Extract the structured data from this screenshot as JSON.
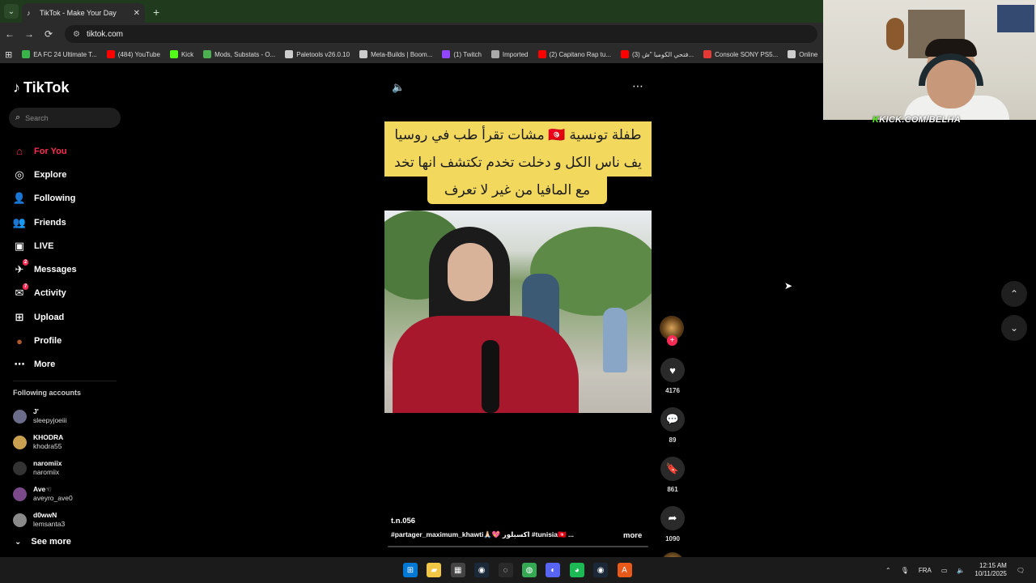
{
  "browser": {
    "tab_title": "TikTok - Make Your Day",
    "tab_close": "✕",
    "new_tab": "+",
    "url": "tiktok.com",
    "nav": {
      "back": "←",
      "forward": "→",
      "reload": "⟳"
    },
    "bookmarks": [
      {
        "label": "EA FC 24 Ultimate T...",
        "color": "#3ab54a"
      },
      {
        "label": "(484) YouTube",
        "color": "#ff0000"
      },
      {
        "label": "Kick",
        "color": "#53fc18"
      },
      {
        "label": "Mods, Substats - O...",
        "color": "#4caf50"
      },
      {
        "label": "Paletools v26.0.10",
        "color": "#cccccc"
      },
      {
        "label": "Meta-Builds | Boom...",
        "color": "#cccccc"
      },
      {
        "label": "(1) Twitch",
        "color": "#9146ff"
      },
      {
        "label": "Imported",
        "color": "#aaaaaa"
      },
      {
        "label": "(2) Capitano Rap tu...",
        "color": "#ff0000"
      },
      {
        "label": "(3) فتحي الكومبا \"ش...",
        "color": "#ff0000"
      },
      {
        "label": "Console SONY PS5...",
        "color": "#e53935"
      },
      {
        "label": "Online",
        "color": "#cccccc"
      }
    ]
  },
  "sidebar": {
    "logo": "TikTok",
    "search_placeholder": "Search",
    "nav": [
      {
        "label": "For You",
        "icon": "home-icon",
        "glyph": "⌂",
        "active": true
      },
      {
        "label": "Explore",
        "icon": "compass-icon",
        "glyph": "◎"
      },
      {
        "label": "Following",
        "icon": "following-icon",
        "glyph": "👤"
      },
      {
        "label": "Friends",
        "icon": "friends-icon",
        "glyph": "👥"
      },
      {
        "label": "LIVE",
        "icon": "live-icon",
        "glyph": "▣"
      },
      {
        "label": "Messages",
        "icon": "messages-icon",
        "glyph": "✈",
        "badge": "2"
      },
      {
        "label": "Activity",
        "icon": "activity-icon",
        "glyph": "✉",
        "badge": "7"
      },
      {
        "label": "Upload",
        "icon": "upload-icon",
        "glyph": "⊞"
      },
      {
        "label": "Profile",
        "icon": "profile-icon",
        "glyph": "●"
      },
      {
        "label": "More",
        "icon": "more-icon",
        "glyph": "⋯"
      }
    ],
    "following_title": "Following accounts",
    "accounts": [
      {
        "name": "J'",
        "username": "sleepyjoeiii",
        "color": "#6b6b8a"
      },
      {
        "name": "KHODRA",
        "username": "khodra55",
        "color": "#c8a050"
      },
      {
        "name": "naromiix",
        "username": "naromiix",
        "color": "#333333"
      },
      {
        "name": "Ave☜",
        "username": "aveyro_ave0",
        "color": "#7a4a8a"
      },
      {
        "name": "d0wwN",
        "username": "lemsanta3",
        "color": "#8a8a8a"
      }
    ],
    "see_more": "See more"
  },
  "video": {
    "caption_lines": [
      "طفلة تونسية 🇹🇳 مشات تقرأ طب في روسيا",
      "يف ناس الكل و دخلت تخدم تكتشف انها تخد",
      "مع المافيا من غير لا تعرف"
    ],
    "author": "t.n.056",
    "tags": "#partager_maximum_khawti🙏🏻💖 اكسبلور #tunisia🇹🇳 ...",
    "more": "more",
    "progress": 0.0
  },
  "actions": {
    "likes": "4176",
    "comments": "89",
    "saves": "861",
    "shares": "1090",
    "follow_plus": "+"
  },
  "overlay": {
    "kick_url_prefix": "K",
    "kick_url": "KICK.COM/BELHA"
  },
  "taskbar": {
    "lang": "FRA",
    "time": "12:15 AM",
    "date": "10/11/2025",
    "apps": [
      {
        "name": "windows-start-icon",
        "glyph": "⊞",
        "color": "#0078d4"
      },
      {
        "name": "file-explorer-icon",
        "glyph": "▰",
        "color": "#f2c744"
      },
      {
        "name": "store-icon",
        "glyph": "▦",
        "color": "#444444"
      },
      {
        "name": "steam-icon",
        "glyph": "◉",
        "color": "#1b2838"
      },
      {
        "name": "obs-icon",
        "glyph": "◌",
        "color": "#2a2a2a"
      },
      {
        "name": "chrome-icon",
        "glyph": "◍",
        "color": "#34a853"
      },
      {
        "name": "discord-icon",
        "glyph": "◐",
        "color": "#5865f2"
      },
      {
        "name": "spotify-icon",
        "glyph": "◕",
        "color": "#1db954"
      },
      {
        "name": "steam-alt-icon",
        "glyph": "◉",
        "color": "#1b2838"
      },
      {
        "name": "app-a-icon",
        "glyph": "A",
        "color": "#e8591a"
      }
    ]
  }
}
